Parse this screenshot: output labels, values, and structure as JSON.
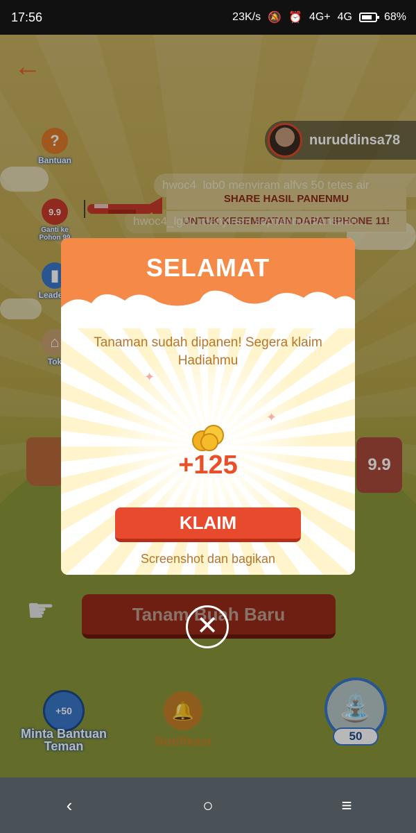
{
  "status_bar": {
    "time": "17:56",
    "net_speed": "23K/s",
    "signal1": "4G+",
    "signal2": "4G",
    "battery": "68%"
  },
  "game": {
    "side_buttons": [
      {
        "label": "Bantuan",
        "icon": "question-icon"
      },
      {
        "label": "Ganti ke Pohon 99",
        "badge": "9.9"
      },
      {
        "label": "Leaderb",
        "icon": "leaderboard-icon"
      },
      {
        "label": "Tok",
        "icon": "shop-icon"
      }
    ],
    "username": "nuruddinsa78",
    "tickers": [
      "hwoc4_lgb0 menyiram alfys 50 tetes air",
      "hwoc4_lgb0 menyiram septiannurdianshari..."
    ],
    "banner_lines": [
      "SHARE HASIL PANENMU",
      "UNTUK KESEMPATAN DAPAT IPHONE 11!"
    ],
    "can_badge": "9.9",
    "plant_button_label": "Tanam Buah Baru",
    "help_bubble": "+50",
    "help_label": "Minta Bantuan Teman",
    "notif_label": "Notifikasi",
    "water_count": "50"
  },
  "modal": {
    "title": "SELAMAT",
    "message": "Tanaman sudah dipanen! Segera klaim Hadiahmu",
    "reward": "+125",
    "claim_label": "KLAIM",
    "share_text": "Screenshot dan bagikan"
  },
  "colors": {
    "accent": "#f58a48",
    "claim": "#e84a2e",
    "text_warm": "#b8752a"
  }
}
